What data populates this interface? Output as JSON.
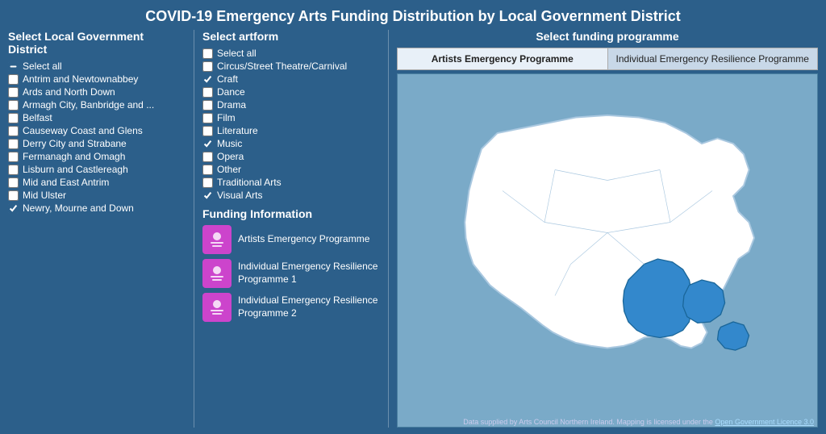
{
  "title": "COVID-19 Emergency Arts Funding Distribution by Local Government District",
  "leftSection": {
    "heading": "Select Local Government District",
    "districts": [
      {
        "label": "Select all",
        "checked": false,
        "indeterminate": true
      },
      {
        "label": "Antrim and Newtownabbey",
        "checked": false
      },
      {
        "label": "Ards and North Down",
        "checked": false
      },
      {
        "label": "Armagh City, Banbridge and ...",
        "checked": false
      },
      {
        "label": "Belfast",
        "checked": false
      },
      {
        "label": "Causeway Coast and Glens",
        "checked": false
      },
      {
        "label": "Derry City and Strabane",
        "checked": false
      },
      {
        "label": "Fermanagh and Omagh",
        "checked": false
      },
      {
        "label": "Lisburn and Castlereagh",
        "checked": false
      },
      {
        "label": "Mid and East Antrim",
        "checked": false
      },
      {
        "label": "Mid Ulster",
        "checked": false
      },
      {
        "label": "Newry, Mourne and Down",
        "checked": true
      }
    ]
  },
  "midSection": {
    "heading": "Select artform",
    "artforms": [
      {
        "label": "Select all",
        "checked": false
      },
      {
        "label": "Circus/Street Theatre/Carnival",
        "checked": false
      },
      {
        "label": "Craft",
        "checked": true
      },
      {
        "label": "Dance",
        "checked": false
      },
      {
        "label": "Drama",
        "checked": false
      },
      {
        "label": "Film",
        "checked": false
      },
      {
        "label": "Literature",
        "checked": false
      },
      {
        "label": "Music",
        "checked": true
      },
      {
        "label": "Opera",
        "checked": false
      },
      {
        "label": "Other",
        "checked": false
      },
      {
        "label": "Traditional Arts",
        "checked": false
      },
      {
        "label": "Visual Arts",
        "checked": true
      }
    ]
  },
  "rightSection": {
    "heading": "Select funding programme",
    "tabs": [
      {
        "label": "Artists Emergency Programme",
        "active": true
      },
      {
        "label": "Individual Emergency Resilience Programme",
        "active": false
      }
    ],
    "mapCaption": "Data supplied by Arts Council Northern Ireland. Mapping is licensed under the Open Government Licence 3.0"
  },
  "fundingInfo": {
    "heading": "Funding Information",
    "items": [
      {
        "icon": "🎭",
        "label": "Artists Emergency Programme"
      },
      {
        "icon": "🎭",
        "label": "Individual Emergency Resilience Programme 1"
      },
      {
        "icon": "🎭",
        "label": "Individual Emergency Resilience Programme 2"
      }
    ]
  }
}
